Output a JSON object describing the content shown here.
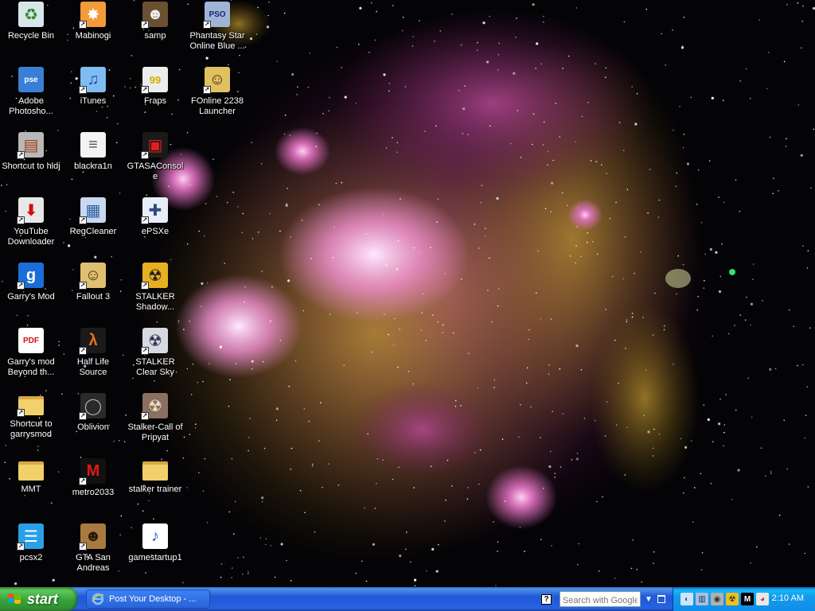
{
  "desktop": {
    "icons": [
      {
        "label": "Recycle Bin",
        "glyph": "♻",
        "bg": "#d8e6ea",
        "fg": "#2d8a2d",
        "shortcut": false
      },
      {
        "label": "Adobe Photosho...",
        "glyph": "pse",
        "bg": "#3a7fd5",
        "fg": "#ffffff",
        "shortcut": false
      },
      {
        "label": "Shortcut to hldj",
        "glyph": "▤",
        "bg": "#b8b8b8",
        "fg": "#a04010",
        "shortcut": true
      },
      {
        "label": "YouTube Downloader",
        "glyph": "⬇",
        "bg": "#e8e8e8",
        "fg": "#d01010",
        "shortcut": true
      },
      {
        "label": "Garry's Mod",
        "glyph": "g",
        "bg": "#1b6ed8",
        "fg": "#ffffff",
        "shortcut": true
      },
      {
        "label": "Garry's mod Beyond th...",
        "glyph": "PDF",
        "bg": "#ffffff",
        "fg": "#cc1111",
        "shortcut": false
      },
      {
        "label": "Shortcut to garrysmod",
        "glyph": "",
        "bg": "#f2d06b",
        "fg": "#b08a20",
        "shortcut": true
      },
      {
        "label": "MMT",
        "glyph": "",
        "bg": "#f2d06b",
        "fg": "#b08a20",
        "shortcut": false
      },
      {
        "label": "pcsx2",
        "glyph": "☰",
        "bg": "#2aa0e8",
        "fg": "#ffffff",
        "shortcut": true
      },
      {
        "label": "Mabinogi",
        "glyph": "✸",
        "bg": "#f39a3a",
        "fg": "#ffffff",
        "shortcut": true
      },
      {
        "label": "iTunes",
        "glyph": "♫",
        "bg": "#7fbcf0",
        "fg": "#1a4fa0",
        "shortcut": true
      },
      {
        "label": "blackra1n",
        "glyph": "≡",
        "bg": "#f4f4f4",
        "fg": "#555555",
        "shortcut": false
      },
      {
        "label": "RegCleaner",
        "glyph": "▦",
        "bg": "#c8d8f0",
        "fg": "#3060a0",
        "shortcut": true
      },
      {
        "label": "Fallout 3",
        "glyph": "☺",
        "bg": "#e0c070",
        "fg": "#3a2a10",
        "shortcut": true
      },
      {
        "label": "Half Life Source",
        "glyph": "λ",
        "bg": "#1a1a1a",
        "fg": "#e8701a",
        "shortcut": true
      },
      {
        "label": "Oblivion",
        "glyph": "◯",
        "bg": "#2a2a2a",
        "fg": "#aaaaaa",
        "shortcut": true
      },
      {
        "label": "metro2033",
        "glyph": "M",
        "bg": "#111111",
        "fg": "#e01818",
        "shortcut": true
      },
      {
        "label": "GTA San Andreas",
        "glyph": "☻",
        "bg": "#a87a40",
        "fg": "#2a1a0a",
        "shortcut": true
      },
      {
        "label": "samp",
        "glyph": "☻",
        "bg": "#6a5030",
        "fg": "#eeeeee",
        "shortcut": true
      },
      {
        "label": "Fraps",
        "glyph": "99",
        "bg": "#ededed",
        "fg": "#d0b000",
        "shortcut": true
      },
      {
        "label": "GTASAConsole",
        "glyph": "▣",
        "bg": "#1a1a1a",
        "fg": "#e02020",
        "shortcut": true
      },
      {
        "label": "ePSXe",
        "glyph": "✚",
        "bg": "#e8eef8",
        "fg": "#304880",
        "shortcut": true
      },
      {
        "label": "STALKER Shadow...",
        "glyph": "☢",
        "bg": "#e8b020",
        "fg": "#1a1a1a",
        "shortcut": true
      },
      {
        "label": "STALKER Clear Sky",
        "glyph": "☢",
        "bg": "#d8d8e0",
        "fg": "#303050",
        "shortcut": true
      },
      {
        "label": "Stalker-Call of Pripyat",
        "glyph": "☢",
        "bg": "#8a7060",
        "fg": "#f0e0c0",
        "shortcut": true
      },
      {
        "label": "stalker trainer",
        "glyph": "",
        "bg": "#f2d06b",
        "fg": "#b08a20",
        "shortcut": false
      },
      {
        "label": "gamestartup1",
        "glyph": "♪",
        "bg": "#ffffff",
        "fg": "#3060c0",
        "shortcut": false
      },
      {
        "label": "Phantasy Star Online Blue ...",
        "glyph": "PSO",
        "bg": "#a0b4d8",
        "fg": "#102a70",
        "shortcut": true
      },
      {
        "label": "FOnline 2238 Launcher",
        "glyph": "☺",
        "bg": "#e0c060",
        "fg": "#3a2a10",
        "shortcut": true
      }
    ]
  },
  "taskbar": {
    "start_label": "start",
    "window_title": "Post Your Desktop - ...",
    "help_glyph": "?",
    "search_placeholder": "Search with Google",
    "dropdown_glyph": "▼",
    "tray_icons": [
      {
        "name": "network-icon",
        "glyph": "◐",
        "bg": "#d0e4f8",
        "fg": "#2060b0"
      },
      {
        "name": "computer-icon",
        "glyph": "▥",
        "bg": "#a8c0e0",
        "fg": "#203050"
      },
      {
        "name": "volume-icon",
        "glyph": "◉",
        "bg": "#b0b0b0",
        "fg": "#303030"
      },
      {
        "name": "stalker-tray-icon",
        "glyph": "☢",
        "bg": "#f0c020",
        "fg": "#1a1a1a"
      },
      {
        "name": "m-icon",
        "glyph": "M",
        "bg": "#000000",
        "fg": "#ffffff"
      },
      {
        "name": "chrome-icon",
        "glyph": "◕",
        "bg": "#e8e8e8",
        "fg": "#d03020"
      }
    ],
    "clock": "2:10 AM"
  },
  "colors": {
    "taskbar_blue": "#2157d7",
    "start_green": "#37a337",
    "tray_blue": "#139beb"
  }
}
